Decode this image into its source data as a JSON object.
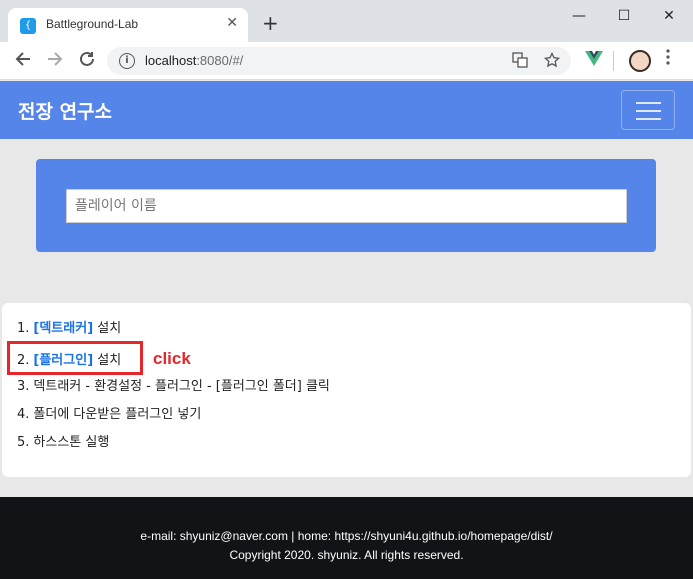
{
  "browser": {
    "tab_title": "Battleground-Lab",
    "tab_favicon": "{ }",
    "close_glyph": "✕",
    "new_tab_glyph": "+",
    "url_host": "localhost",
    "url_rest": ":8080/#/",
    "window_controls": {
      "minimize": "—",
      "maximize": "☐",
      "close": "✕"
    }
  },
  "navbar": {
    "brand": "전장 연구소"
  },
  "search": {
    "placeholder": "플레이어 이름"
  },
  "steps": [
    {
      "num": "1.",
      "link": "[덱트래커]",
      "text": " 설치"
    },
    {
      "num": "2.",
      "link": "[플러그인]",
      "text": " 설치"
    },
    {
      "num": "3.",
      "link": "",
      "text": "덱트래커 - 환경설정 - 플러그인 - [플러그인 폴더] 클릭"
    },
    {
      "num": "4.",
      "link": "",
      "text": "폴더에 다운받은 플러그인 넣기"
    },
    {
      "num": "5.",
      "link": "",
      "text": "하스스톤 실행"
    }
  ],
  "annotation": {
    "label": "click",
    "color": "#e5262b"
  },
  "footer": {
    "contact": "e-mail: shyuniz@naver.com | home: https://shyuni4u.github.io/homepage/dist/",
    "copyright": "Copyright 2020. shyuniz. All rights reserved."
  },
  "colors": {
    "primary": "#5585e8",
    "footer_bg": "#111317",
    "link": "#1a73e8"
  }
}
